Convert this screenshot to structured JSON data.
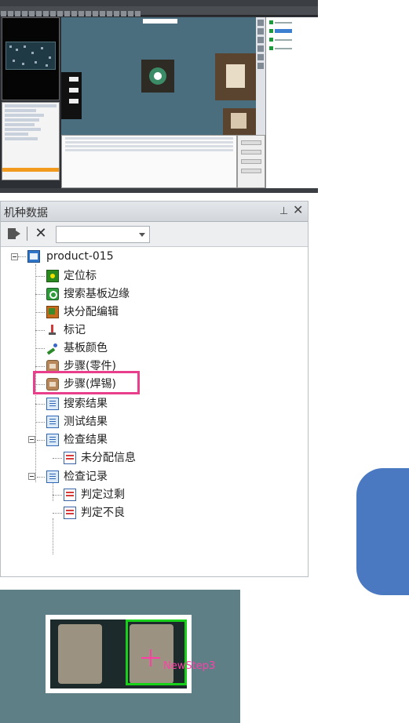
{
  "panel": {
    "title": "机种数据",
    "pin_icon": "pin-icon",
    "close_icon": "close-icon",
    "toolbar": {
      "export_icon": "export-icon",
      "delete_icon": "delete-icon",
      "combo_value": ""
    }
  },
  "tree": {
    "root": "product-015",
    "items": [
      {
        "label": "定位标",
        "icon": "locator-icon"
      },
      {
        "label": "搜索基板边缘",
        "icon": "search-edge-icon"
      },
      {
        "label": "块分配编辑",
        "icon": "block-assign-icon"
      },
      {
        "label": "标记",
        "icon": "mark-icon"
      },
      {
        "label": "基板颜色",
        "icon": "board-color-icon"
      },
      {
        "label": "步骤(零件)",
        "icon": "part-step-icon"
      },
      {
        "label": "步骤(焊锡)",
        "icon": "solder-step-icon"
      },
      {
        "label": "搜索结果",
        "icon": "doc-icon"
      },
      {
        "label": "测试结果",
        "icon": "doc-icon"
      },
      {
        "label": "检查结果",
        "icon": "doc-icon"
      },
      {
        "label": "未分配信息",
        "icon": "list-icon"
      },
      {
        "label": "检查记录",
        "icon": "doc-icon"
      },
      {
        "label": "判定过剩",
        "icon": "list-icon"
      },
      {
        "label": "判定不良",
        "icon": "list-icon"
      }
    ]
  },
  "zoom": {
    "step_label": "NewStep3"
  },
  "colors": {
    "highlight": "#e83e8c",
    "accent_tab": "#4a79c1",
    "inspection_box": "#18d01a",
    "step_text": "#ff3fa6"
  }
}
